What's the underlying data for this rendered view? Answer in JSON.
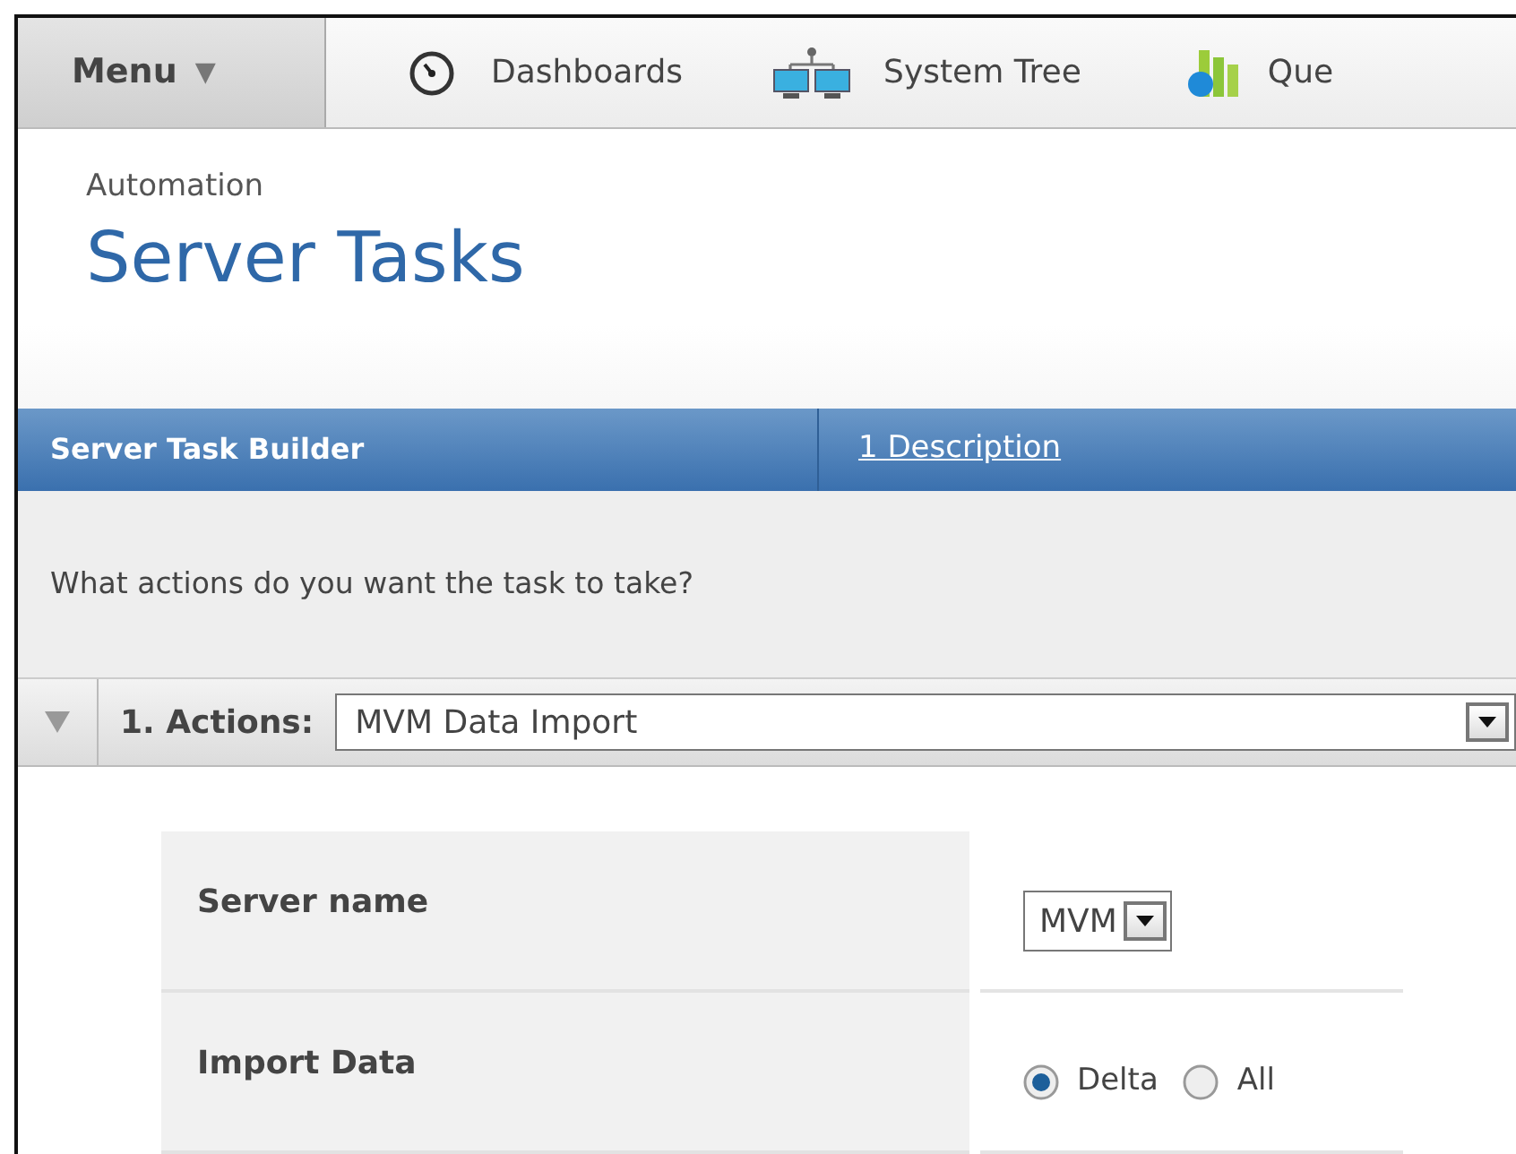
{
  "nav": {
    "menu": {
      "label": "Menu",
      "caret": "▼"
    },
    "items": [
      {
        "kind": "gauge",
        "label": "Dashboards"
      },
      {
        "kind": "network",
        "label": "System Tree"
      },
      {
        "kind": "chart",
        "label": "Que"
      }
    ]
  },
  "breadcrumb": "Automation",
  "title": "Server Tasks",
  "builder": {
    "title": "Server Task Builder",
    "steps": [
      {
        "label": "1 Description"
      }
    ]
  },
  "prompt": "What actions do you want the task to take?",
  "actions": {
    "expanded": true,
    "label": "1. Actions:",
    "value": "MVM Data Import"
  },
  "fields": [
    {
      "kind": "select",
      "label": "Server name",
      "value": "MVM"
    },
    {
      "kind": "radio",
      "label": "Import Data",
      "options": [
        {
          "label": "Delta",
          "selected": true
        },
        {
          "label": "All",
          "selected": false
        }
      ]
    }
  ]
}
